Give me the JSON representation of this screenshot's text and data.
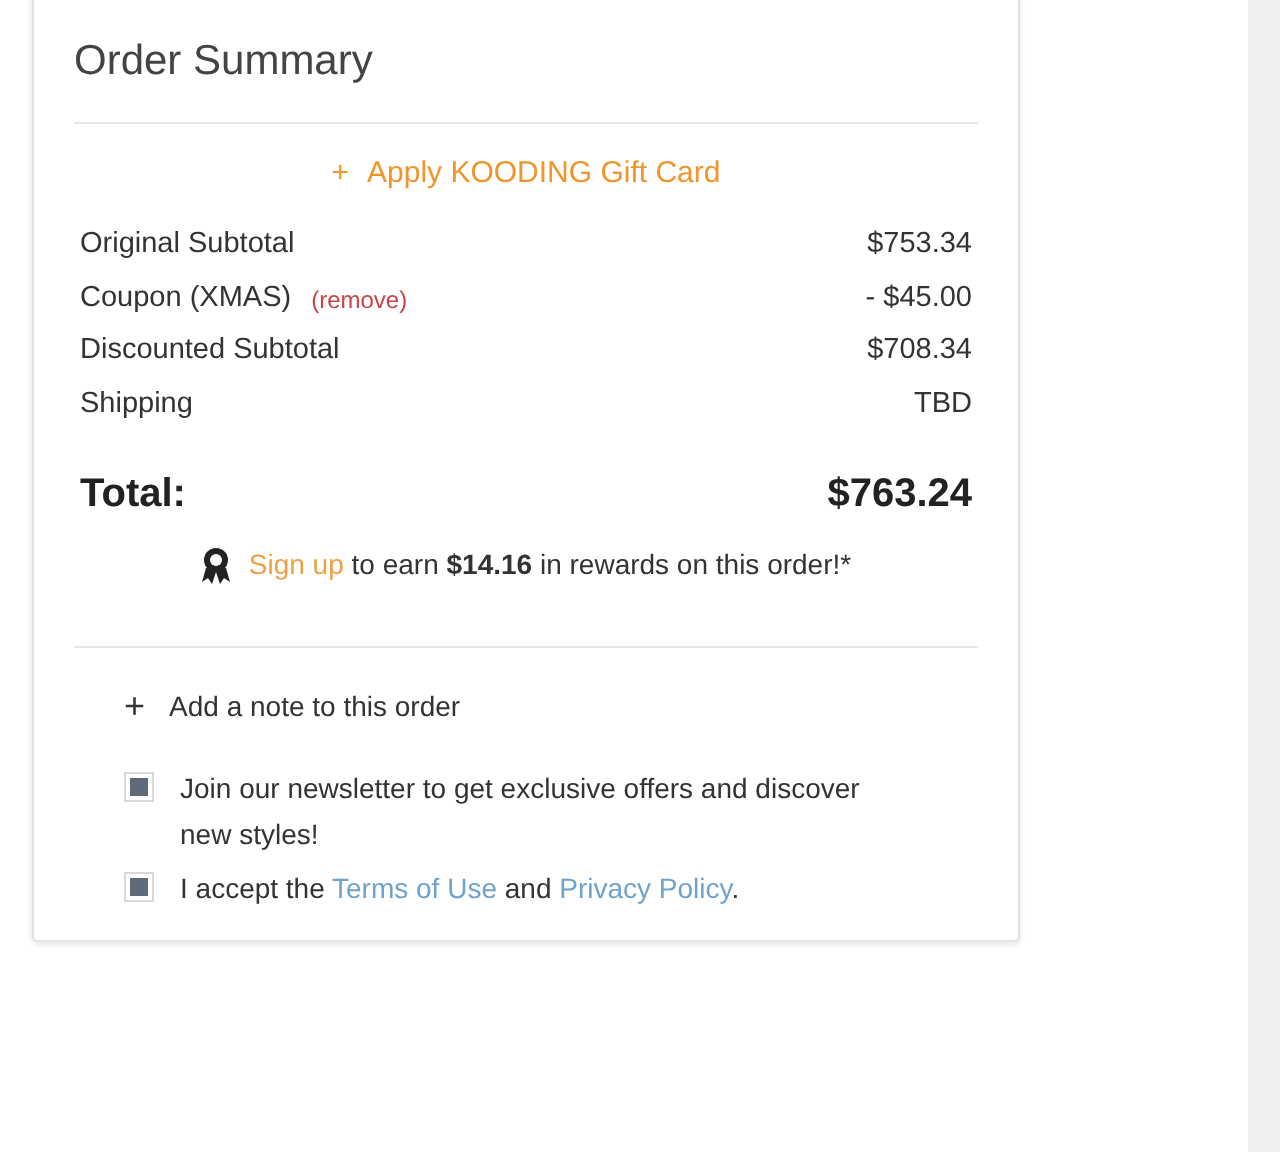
{
  "summary": {
    "title": "Order Summary",
    "gift_card": {
      "icon": "+",
      "label": "Apply KOODING Gift Card"
    },
    "lines": [
      {
        "label": "Original Subtotal",
        "value": "$753.34"
      },
      {
        "label": "Coupon (XMAS)",
        "action": "(remove)",
        "value": "- $45.00"
      },
      {
        "label": "Discounted Subtotal",
        "value": "$708.34"
      },
      {
        "label": "Shipping",
        "value": "TBD"
      }
    ],
    "total": {
      "label": "Total:",
      "value": "$763.24"
    },
    "rewards": {
      "link": "Sign up",
      "text": " to earn **$14.16** in rewards on this order!*"
    },
    "note": {
      "icon": "+",
      "label": "Add a note to this order"
    },
    "options": [
      {
        "kind": "plain",
        "text": "Join our newsletter to get exclusive offers and discover new styles!",
        "checked": true
      },
      {
        "kind": "links",
        "before": "I accept the ",
        "link1": "Terms of Use",
        "middle": " and ",
        "link2": "Privacy Policy",
        "after": ".",
        "checked": true
      }
    ]
  }
}
